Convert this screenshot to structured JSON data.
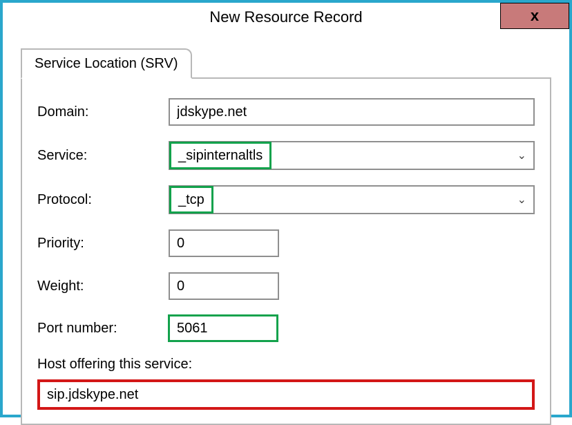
{
  "window": {
    "title": "New Resource Record",
    "close_label": "x"
  },
  "tab": {
    "label": "Service Location (SRV)"
  },
  "labels": {
    "domain": "Domain:",
    "service": "Service:",
    "protocol": "Protocol:",
    "priority": "Priority:",
    "weight": "Weight:",
    "port": "Port number:",
    "host": "Host offering this service:"
  },
  "values": {
    "domain": "jdskype.net",
    "service": "_sipinternaltls",
    "protocol": "_tcp",
    "priority": "0",
    "weight": "0",
    "port": "5061",
    "host": "sip.jdskype.net"
  }
}
